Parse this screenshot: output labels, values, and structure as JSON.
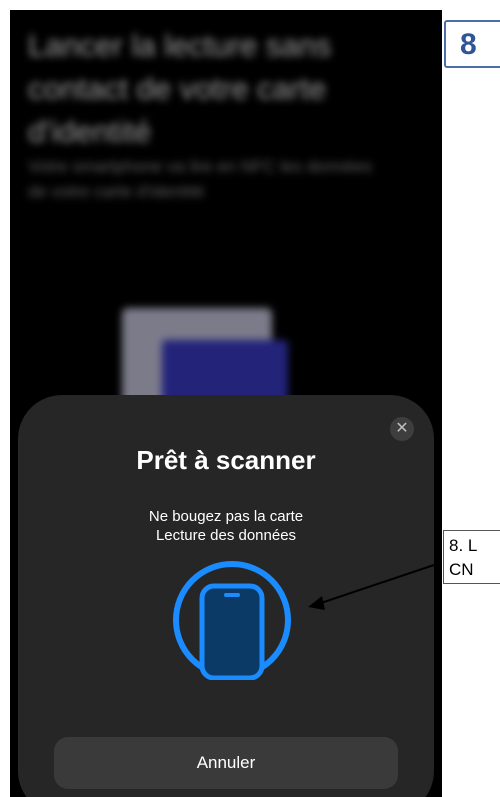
{
  "background_app": {
    "title": "Lancer la lecture sans contact de votre carte d'identité",
    "description": "Votre smartphone va lire en NFC les données de votre carte d'identité"
  },
  "scan_sheet": {
    "title": "Prêt à scanner",
    "message_line1": "Ne bougez pas la carte",
    "message_line2": "Lecture des données",
    "close_icon": "xmark-icon",
    "scan_icon": "phone-in-circle-icon",
    "accent_color": "#1a8cff",
    "cancel_label": "Annuler"
  },
  "annotation": {
    "step_number": "8",
    "callout_text_line1": "8. L",
    "callout_text_line2": "CN"
  }
}
